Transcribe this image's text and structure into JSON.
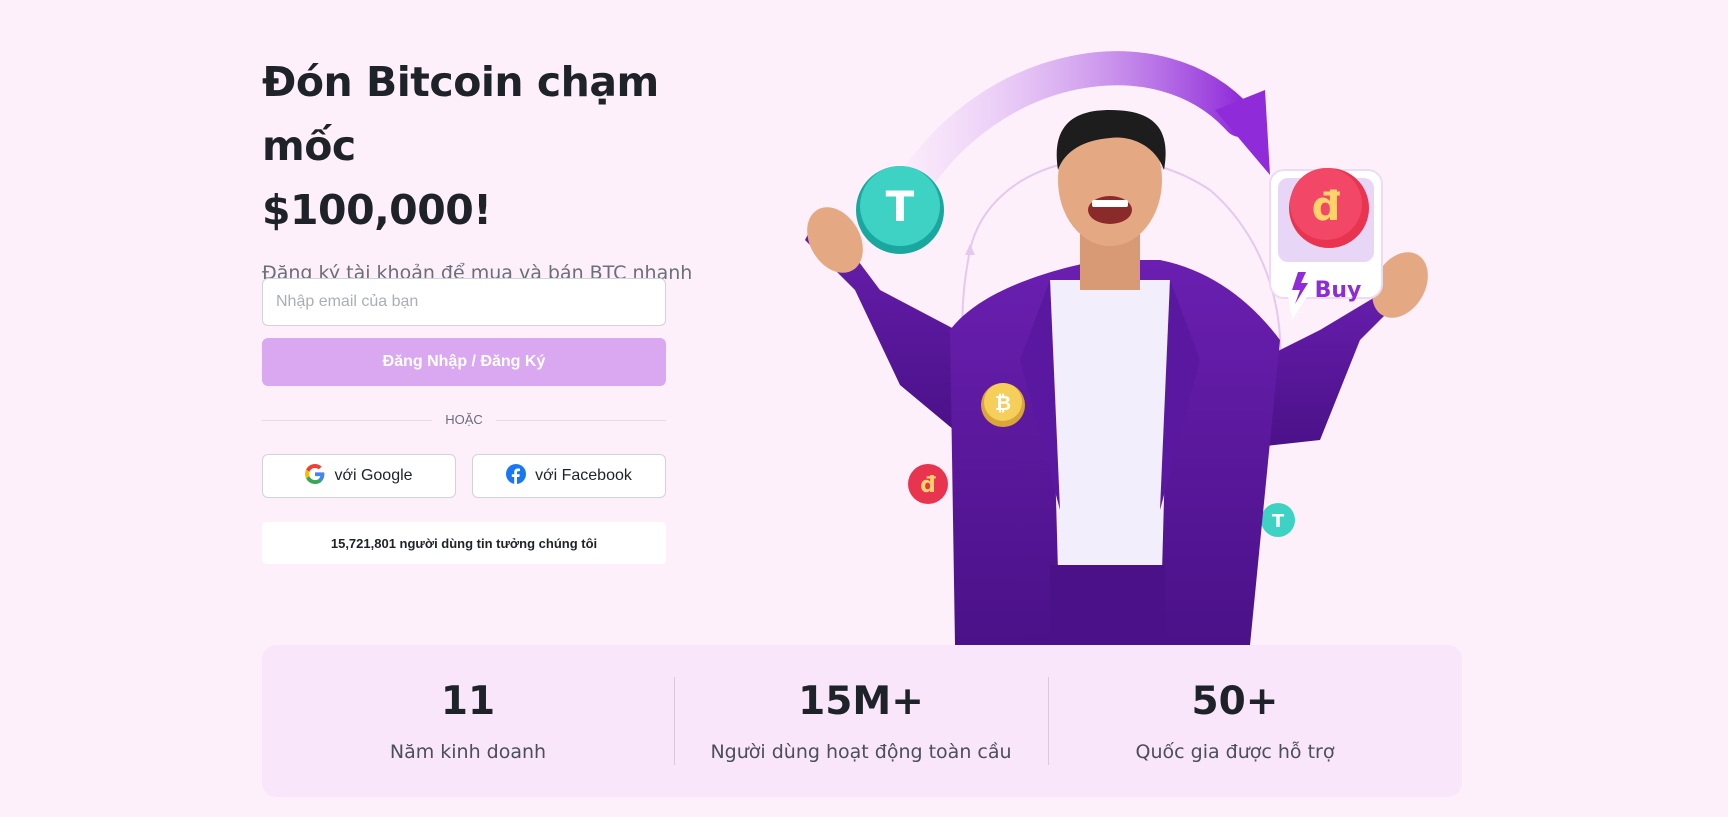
{
  "hero": {
    "title_line1": "Đón Bitcoin chạm mốc",
    "title_line2": "$100,000!",
    "subtitle": "Đăng ký tài khoản để mua và bán BTC nhanh chóng với VND!"
  },
  "form": {
    "email_placeholder": "Nhập email của bạn",
    "login_label": "Đăng Nhập / Đăng Ký",
    "divider_label": "HOẶC",
    "google_label": "với Google",
    "facebook_label": "với Facebook",
    "trust_text": "15,721,801 người dùng tin tưởng chúng tôi"
  },
  "illustration": {
    "buy_label": "Buy",
    "coin_vnd_symbol": "đ",
    "coin_usdt_symbol": "T",
    "coin_btc_symbol": "₿"
  },
  "stats": [
    {
      "value": "11",
      "label": "Năm kinh doanh"
    },
    {
      "value": "15M+",
      "label": "Người dùng hoạt động toàn cầu"
    },
    {
      "value": "50+",
      "label": "Quốc gia được hỗ trợ"
    }
  ],
  "colors": {
    "page_bg": "#fdf0fb",
    "primary_button": "#d9a8f0",
    "stats_bg": "#f9e6fb",
    "accent_purple": "#7b2fbf"
  }
}
